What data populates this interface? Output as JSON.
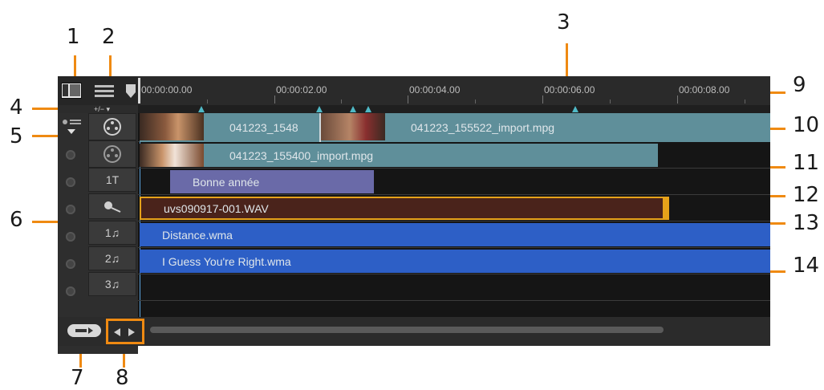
{
  "callouts": [
    "1",
    "2",
    "3",
    "4",
    "5",
    "6",
    "7",
    "8",
    "9",
    "10",
    "11",
    "12",
    "13",
    "14"
  ],
  "ruler": {
    "labels": [
      "00:00:00.00",
      "00:00:02.00",
      "00:00:04.00",
      "00:00:06.00",
      "00:00:08.00"
    ]
  },
  "tracks": {
    "video": {
      "icon": "film-reel-icon",
      "clip1_label": "041223_1548",
      "clip2_label": "041223_155522_import.mpg"
    },
    "overlay": {
      "icon": "film-overlay-icon",
      "clip_label": "041223_155400_import.mpg"
    },
    "title": {
      "icon_label": "1T",
      "clip_label": "Bonne année"
    },
    "voice": {
      "icon": "microphone-icon",
      "clip_label": "uvs090917-001.WAV"
    },
    "music1": {
      "icon_label": "1♫",
      "clip_label": "Distance.wma"
    },
    "music2": {
      "icon_label": "2♫",
      "clip_label": "I Guess You're Right.wma"
    },
    "music3": {
      "icon_label": "3♫"
    }
  },
  "colors": {
    "callout_line": "#ef8a12",
    "video_clip": "#5f8f9a",
    "title_clip": "#6a6aa8",
    "voice_clip": "#4a231b",
    "voice_border": "#e6a21a",
    "music_clip": "#2d5fc6"
  }
}
